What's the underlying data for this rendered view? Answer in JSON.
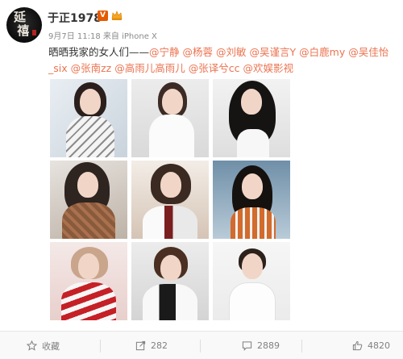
{
  "post": {
    "username": "于正1978",
    "verified_badge": "V",
    "time": "9月7日 11:18",
    "source_prefix": "来自",
    "source": "iPhone X",
    "text_lead": "晒晒我家的女人们——",
    "mentions": [
      "@宁静",
      "@杨蓉",
      "@刘敏",
      "@吴谨言Y",
      "@白鹿my",
      "@吴佳怡_six",
      "@张南zz",
      "@高雨儿高雨儿",
      "@张译兮cc",
      "@欢娱影视"
    ]
  },
  "avatar": {
    "icon": "ink-calligraphy-avatar"
  },
  "photos": [
    {
      "name": "photo-1"
    },
    {
      "name": "photo-2"
    },
    {
      "name": "photo-3"
    },
    {
      "name": "photo-4"
    },
    {
      "name": "photo-5"
    },
    {
      "name": "photo-6"
    },
    {
      "name": "photo-7"
    },
    {
      "name": "photo-8"
    },
    {
      "name": "photo-9"
    }
  ],
  "actions": {
    "favorite_label": "收藏",
    "repost_count": "282",
    "comment_count": "2889",
    "like_count": "4820"
  },
  "colors": {
    "mention": "#eb7350",
    "verified": "#e65a00",
    "meta": "#8a8a8a"
  }
}
